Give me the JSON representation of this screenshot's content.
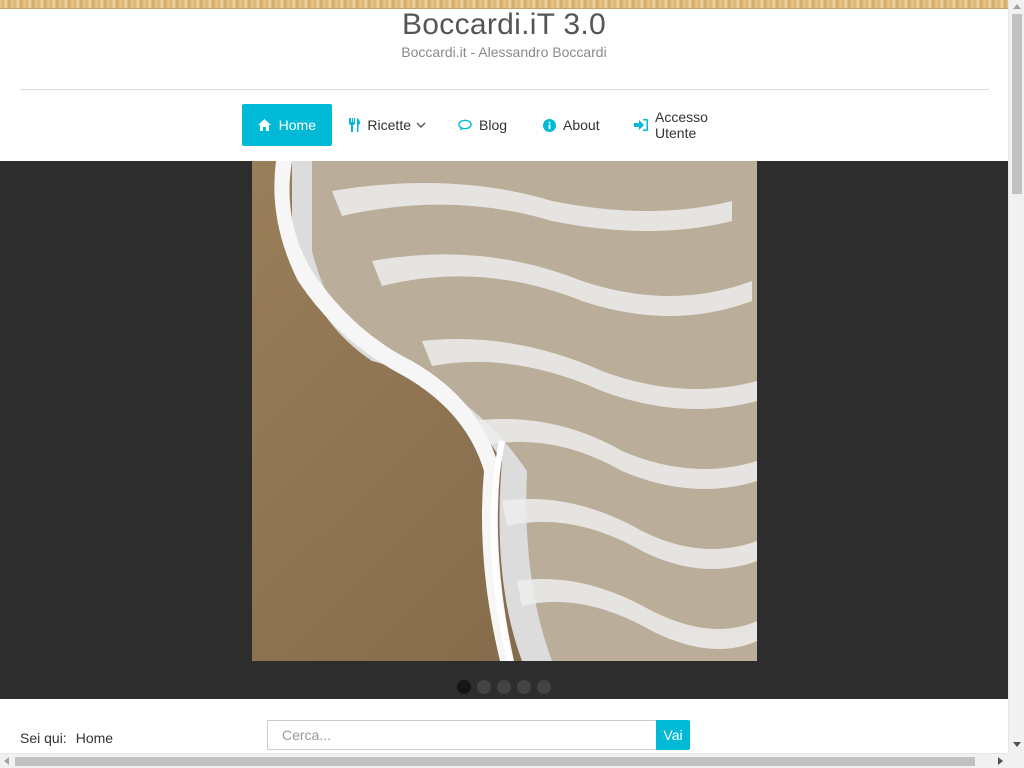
{
  "site": {
    "title": "Boccardi.iT 3.0",
    "subtitle": "Boccardi.it - Alessandro Boccardi"
  },
  "nav": {
    "items": [
      {
        "label": "Home",
        "icon": "home-icon",
        "active": true
      },
      {
        "label": "Ricette",
        "icon": "cutlery-icon",
        "has_dropdown": true
      },
      {
        "label": "Blog",
        "icon": "comment-icon"
      },
      {
        "label": "About",
        "icon": "info-icon"
      },
      {
        "label": "Accesso Utente",
        "icon": "sign-in-icon"
      }
    ]
  },
  "slider": {
    "slide_count": 5,
    "active_slide": 1,
    "image": "beach-wave-photo"
  },
  "breadcrumb": {
    "prefix": "Sei qui:",
    "current": "Home"
  },
  "search": {
    "placeholder": "Cerca...",
    "button_label": "Vai"
  },
  "colors": {
    "accent": "#00b9d6",
    "slider_bg": "#2d2d2d"
  }
}
